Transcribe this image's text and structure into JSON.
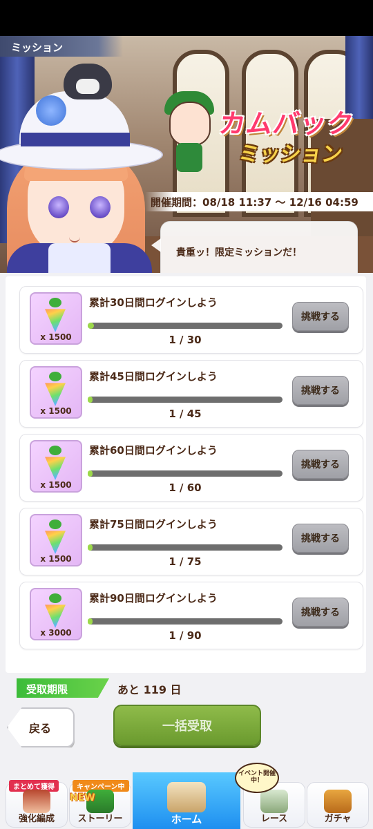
{
  "header": {
    "section_tag": "ミッション"
  },
  "banner": {
    "logo_line1": "カムバック",
    "logo_line2": "ミッション",
    "period": "開催期間：08/18 11:37 ～ 12/16 04:59",
    "speech": "貴重ッ！限定ミッションだ！"
  },
  "missions": [
    {
      "title": "累計30日間ログインしよう",
      "reward_qty": "x 1500",
      "progress_text": "1 / 30",
      "progress_fraction": 0.033,
      "button": "挑戦する"
    },
    {
      "title": "累計45日間ログインしよう",
      "reward_qty": "x 1500",
      "progress_text": "1 / 45",
      "progress_fraction": 0.022,
      "button": "挑戦する"
    },
    {
      "title": "累計60日間ログインしよう",
      "reward_qty": "x 1500",
      "progress_text": "1 / 60",
      "progress_fraction": 0.017,
      "button": "挑戦する"
    },
    {
      "title": "累計75日間ログインしよう",
      "reward_qty": "x 1500",
      "progress_text": "1 / 75",
      "progress_fraction": 0.013,
      "button": "挑戦する"
    },
    {
      "title": "累計90日間ログインしよう",
      "reward_qty": "x 3000",
      "progress_text": "1 / 90",
      "progress_fraction": 0.011,
      "button": "挑戦する"
    }
  ],
  "deadline": {
    "label": "受取期限",
    "value": "あと 119 日"
  },
  "actions": {
    "back": "戻る",
    "collect_all": "一括受取"
  },
  "nav": {
    "items": [
      {
        "label": "強化編成",
        "badge": "まとめて獲得"
      },
      {
        "label": "ストーリー",
        "badge": "キャンペーン中",
        "new": "NEW"
      },
      {
        "label": "ホーム"
      },
      {
        "label": "レース",
        "badge": "イベント開催中！"
      },
      {
        "label": "ガチャ"
      }
    ]
  },
  "colors": {
    "accent_green": "#6a9a2e",
    "text_brown": "#4b2a18",
    "progress_fill": "#9cd84a",
    "home_blue": "#1e8ff0"
  },
  "icons": [
    "carrot-icon",
    "chevron-left-icon",
    "home-building-icon"
  ]
}
